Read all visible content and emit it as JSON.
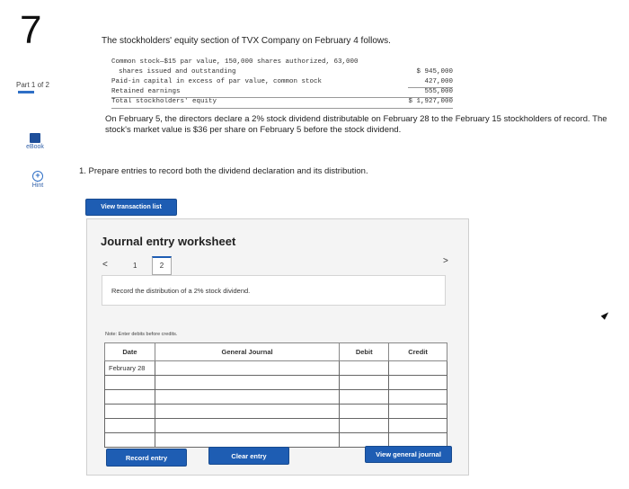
{
  "question_number": "7",
  "part_label": "Part 1 of 2",
  "sidebar": {
    "ebook_label": "eBook",
    "hint_label": "Hint",
    "hint_icon_glyph": "+"
  },
  "problem": {
    "intro": "The stockholders' equity section of TVX Company on February 4 follows.",
    "equity_rows": [
      {
        "label": "Common stock—$15 par value, 150,000 shares authorized, 63,000",
        "value": ""
      },
      {
        "label": "   shares issued and outstanding",
        "value": "$ 945,000"
      },
      {
        "label": "Paid-in capital in excess of par value, common stock",
        "value": "427,000"
      },
      {
        "label": "Retained earnings",
        "value": "555,000"
      },
      {
        "label": "Total stockholders' equity",
        "value": "$ 1,927,000"
      }
    ],
    "paragraph": "On February 5, the directors declare a 2% stock dividend distributable on February 28 to the February 15 stockholders of record. The stock's market value is $36 per share on February 5 before the stock dividend.",
    "requirement": "1. Prepare entries to record both the dividend declaration and its distribution."
  },
  "buttons": {
    "view_transaction_list": "View transaction list",
    "record_entry": "Record entry",
    "clear_entry": "Clear entry",
    "view_general_journal": "View general journal"
  },
  "worksheet": {
    "title": "Journal entry worksheet",
    "prev_glyph": "<",
    "next_glyph": ">",
    "pages": [
      "1",
      "2"
    ],
    "instruction": "Record the distribution of a 2% stock dividend.",
    "note": "Note: Enter debits before credits.",
    "columns": {
      "date": "Date",
      "general_journal": "General Journal",
      "debit": "Debit",
      "credit": "Credit"
    },
    "rows": [
      {
        "date": "February 28",
        "account": "",
        "debit": "",
        "credit": ""
      },
      {
        "date": "",
        "account": "",
        "debit": "",
        "credit": ""
      },
      {
        "date": "",
        "account": "",
        "debit": "",
        "credit": ""
      },
      {
        "date": "",
        "account": "",
        "debit": "",
        "credit": ""
      },
      {
        "date": "",
        "account": "",
        "debit": "",
        "credit": ""
      },
      {
        "date": "",
        "account": "",
        "debit": "",
        "credit": ""
      }
    ]
  },
  "colors": {
    "accent": "#1e5db3"
  }
}
